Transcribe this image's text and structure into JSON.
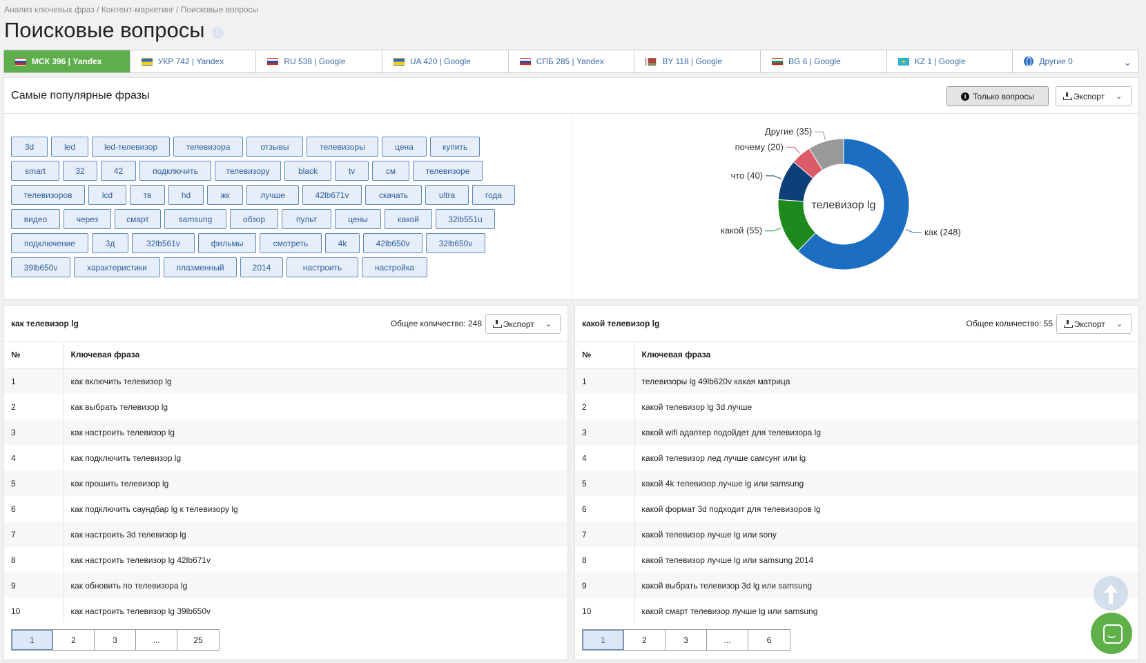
{
  "breadcrumb": "Анализ ключевых фраз / Контент-маркетинг / Поисковые вопросы",
  "page_title": "Поисковые вопросы",
  "info_glyph": "i",
  "region_tabs": [
    {
      "label": "МСК 396 | Yandex",
      "flag": "ru",
      "active": true
    },
    {
      "label": "УКР 742 | Yandex",
      "flag": "ua",
      "active": false
    },
    {
      "label": "RU 538 | Google",
      "flag": "ru",
      "active": false
    },
    {
      "label": "UA 420 | Google",
      "flag": "ua",
      "active": false
    },
    {
      "label": "СПБ 285 | Yandex",
      "flag": "ru",
      "active": false
    },
    {
      "label": "BY 118 | Google",
      "flag": "by",
      "active": false
    },
    {
      "label": "BG 6 | Google",
      "flag": "bg",
      "active": false
    },
    {
      "label": "KZ 1 | Google",
      "flag": "kz",
      "active": false
    },
    {
      "label": "Другие 0",
      "flag": "globe",
      "active": false
    }
  ],
  "tab_chevron": "⌄",
  "top_panel": {
    "title": "Самые популярные фразы",
    "questions_button": "Только вопросы",
    "export_button": "Экспорт",
    "export_chevron": "⌄"
  },
  "tag_rows": [
    [
      "3d",
      "led",
      "led-телевизор",
      "телевизора",
      "отзывы",
      "телевизоры",
      "цена",
      "купить"
    ],
    [
      "smart",
      "32",
      "42",
      "подключить",
      "телевизору",
      "black",
      "tv",
      "см",
      "телевизоре"
    ],
    [
      "телевизоров",
      "lcd",
      "тв",
      "hd",
      "жк",
      "лучше",
      "42lb671v",
      "скачать",
      "ultra",
      "года"
    ],
    [
      "видео",
      "через",
      "смарт",
      "samsung",
      "обзор",
      "пульт",
      "цены",
      "какой",
      "32lb551u"
    ],
    [
      "подключение",
      "3д",
      "32lb561v",
      "фильмы",
      "смотреть",
      "4k",
      "42lb650v",
      "32lb650v"
    ],
    [
      "39lb650v",
      "характеристики",
      "плазменный",
      "2014",
      "настроить",
      "настройка"
    ]
  ],
  "chart_data": {
    "type": "pie",
    "center_label": "телевизор lg",
    "slices": [
      {
        "label": "как",
        "value": 248,
        "display": "как (248)",
        "color": "#1b6ec2"
      },
      {
        "label": "какой",
        "value": 55,
        "display": "какой (55)",
        "color": "#1e8a1e"
      },
      {
        "label": "что",
        "value": 40,
        "display": "что (40)",
        "color": "#0f3f78"
      },
      {
        "label": "почему",
        "value": 20,
        "display": "почему (20)",
        "color": "#db5c68"
      },
      {
        "label": "Другие",
        "value": 35,
        "display": "Другие (35)",
        "color": "#999999"
      }
    ]
  },
  "left_list": {
    "title": "как телевизор lg",
    "total": "Общее количество: 248",
    "export_button": "Экспорт",
    "export_chevron": "⌄",
    "col_num": "№",
    "col_phrase": "Ключевая фраза",
    "rows": [
      {
        "n": "1",
        "phrase": "как включить телевизор lg"
      },
      {
        "n": "2",
        "phrase": "как выбрать телевизор lg"
      },
      {
        "n": "3",
        "phrase": "как настроить телевизор lg"
      },
      {
        "n": "4",
        "phrase": "как подключить телевизор lg"
      },
      {
        "n": "5",
        "phrase": "как прошить телевизор lg"
      },
      {
        "n": "6",
        "phrase": "как подключить саундбар lg к телевизору lg"
      },
      {
        "n": "7",
        "phrase": "как настроить 3d телевизор lg"
      },
      {
        "n": "8",
        "phrase": "как настроить телевизор lg 42lb671v"
      },
      {
        "n": "9",
        "phrase": "как обновить по телевизора lg"
      },
      {
        "n": "10",
        "phrase": "как настроить телевизор lg 39lb650v"
      }
    ],
    "pages": [
      "1",
      "2",
      "3",
      "...",
      "25"
    ]
  },
  "right_list": {
    "title": "какой телевизор lg",
    "total": "Общее количество: 55",
    "export_button": "Экспорт",
    "export_chevron": "⌄",
    "col_num": "№",
    "col_phrase": "Ключевая фраза",
    "rows": [
      {
        "n": "1",
        "phrase": "телевизоры lg 49lb620v какая матрица"
      },
      {
        "n": "2",
        "phrase": "какой телевизор lg 3d лучше"
      },
      {
        "n": "3",
        "phrase": "какой wifi адаптер подойдет для телевизора lg"
      },
      {
        "n": "4",
        "phrase": "какой телевизор лед лучше самсунг или lg"
      },
      {
        "n": "5",
        "phrase": "какой 4k телевизор лучше lg или samsung"
      },
      {
        "n": "6",
        "phrase": "какой формат 3d подходит для телевизоров lg"
      },
      {
        "n": "7",
        "phrase": "какой телевизор лучше lg или sony"
      },
      {
        "n": "8",
        "phrase": "какой телевизор лучше lg или samsung 2014"
      },
      {
        "n": "9",
        "phrase": "какой выбрать телевизор 3d lg или samsung"
      },
      {
        "n": "10",
        "phrase": "какой смарт телевизор лучше lg или samsung"
      }
    ],
    "pages": [
      "1",
      "2",
      "3",
      "...",
      "6"
    ]
  },
  "icons": {
    "flag_ru": "russia-flag-icon",
    "flag_ua": "ukraine-flag-icon",
    "flag_by": "belarus-flag-icon",
    "flag_bg": "bulgaria-flag-icon",
    "flag_kz": "kazakhstan-flag-icon",
    "globe": "globe-icon",
    "info": "info-icon",
    "download": "download-icon",
    "scroll_top": "arrow-up-icon",
    "chat": "chat-icon"
  }
}
